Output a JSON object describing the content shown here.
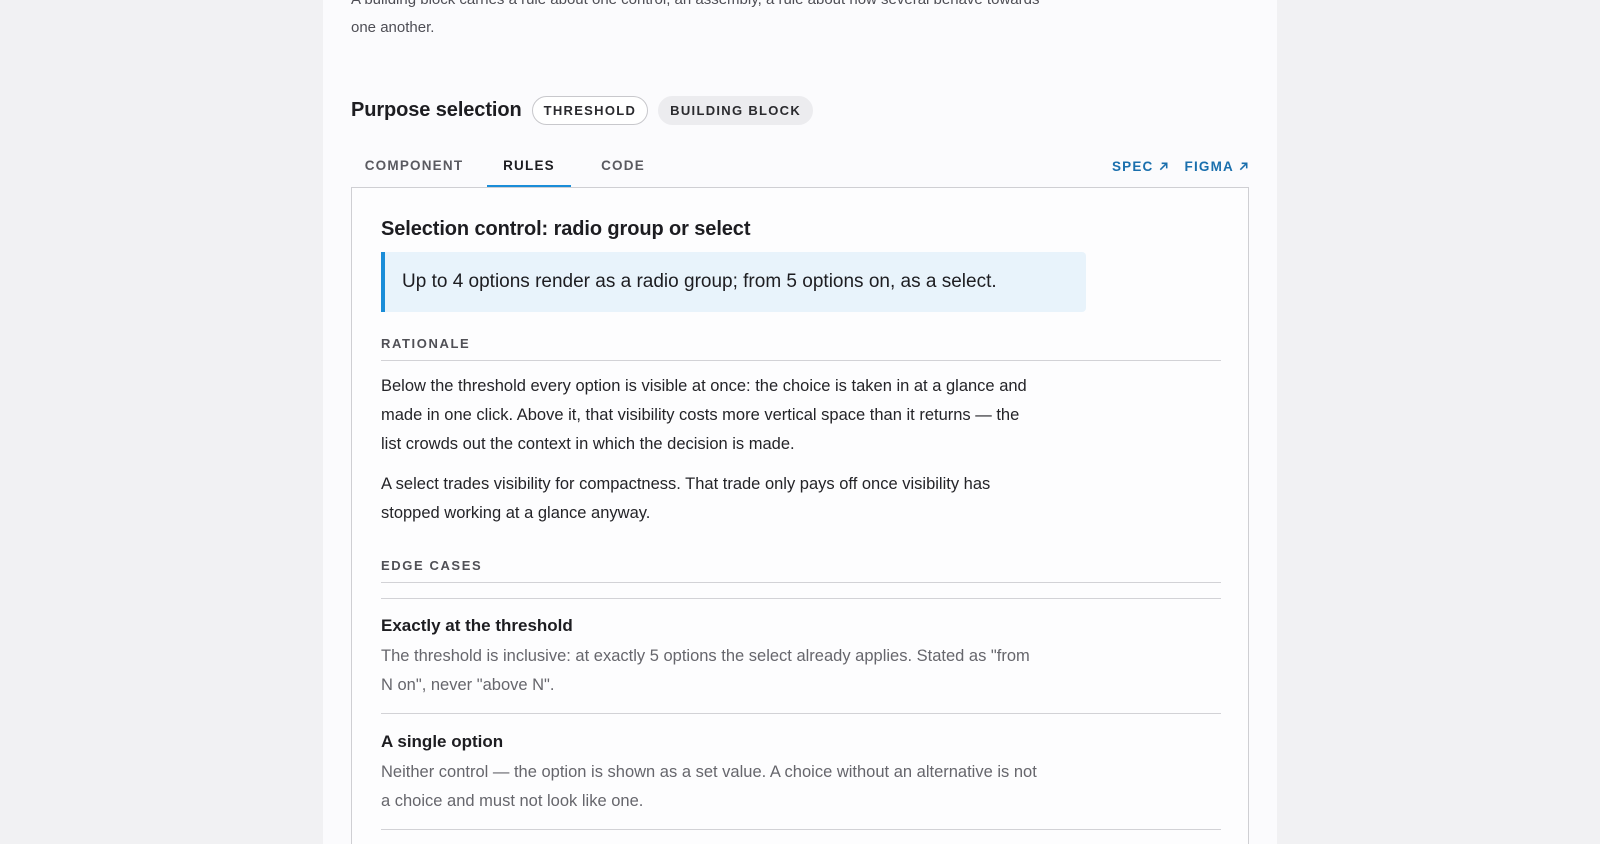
{
  "intro": {
    "text": "A building block carries a rule about one control, an assembly, a rule about how several behave towards one another."
  },
  "purpose": {
    "title": "Purpose selection",
    "tags": [
      "THRESHOLD",
      "BUILDING BLOCK"
    ]
  },
  "tabs": [
    {
      "label": "COMPONENT",
      "active": false
    },
    {
      "label": "RULES",
      "active": true
    },
    {
      "label": "CODE",
      "active": false
    }
  ],
  "links": [
    {
      "label": "SPEC",
      "icon": "external-link-icon"
    },
    {
      "label": "FIGMA",
      "icon": "external-link-icon"
    }
  ],
  "colors": {
    "accent": "#1a8dd8",
    "link": "#1a6fad",
    "callout_bg": "#e8f3fb"
  },
  "rule": {
    "title": "Selection control: radio group or select",
    "summary": "Up to 4 options render as a radio group; from 5 options on, as a select.",
    "rationale_label": "RATIONALE",
    "rationale": [
      "Below the threshold every option is visible at once: the choice is taken in at a glance and made in one click. Above it, that visibility costs more vertical space than it returns — the list crowds out the context in which the decision is made.",
      "A select trades visibility for compactness. That trade only pays off once visibility has stopped working at a glance anyway."
    ],
    "edge_cases_label": "EDGE CASES",
    "edge_cases": [
      {
        "title": "Exactly at the threshold",
        "body": "The threshold is inclusive: at exactly 5 options the select already applies. Stated as \"from N on\", never \"above N\"."
      },
      {
        "title": "A single option",
        "body": "Neither control — the option is shown as a set value. A choice without an alternative is not a choice and must not look like one."
      }
    ]
  }
}
